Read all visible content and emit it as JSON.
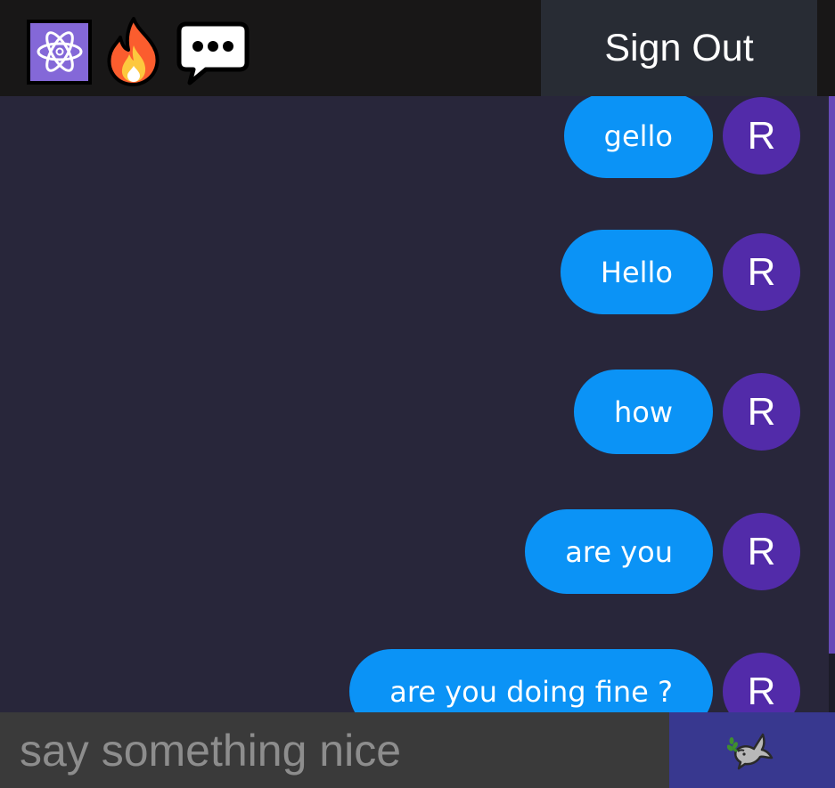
{
  "header": {
    "logo_icon": "react-atom-icon",
    "fire_icon": "fire-icon",
    "chat_icon": "speech-bubble-icon",
    "signout_label": "Sign Out"
  },
  "messages": [
    {
      "text": "gello",
      "avatar": "R"
    },
    {
      "text": "Hello",
      "avatar": "R"
    },
    {
      "text": "how",
      "avatar": "R"
    },
    {
      "text": "are you",
      "avatar": "R"
    },
    {
      "text": "are you doing fine ?",
      "avatar": "R"
    }
  ],
  "composer": {
    "placeholder": "say something nice",
    "value": "",
    "send_icon": "dove-icon"
  },
  "colors": {
    "header_bg": "#181717",
    "signout_bg": "#282c34",
    "chat_bg": "#28263a",
    "bubble": "#0b93f6",
    "avatar": "#522ba9",
    "input_bg": "#3a3a3a",
    "send_bg": "#38388f",
    "scroll_thumb": "#6649b8"
  }
}
